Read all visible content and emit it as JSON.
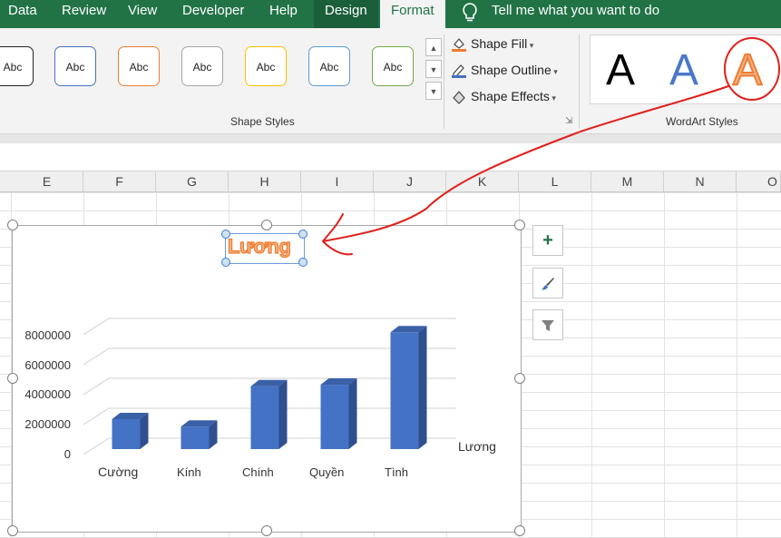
{
  "ribbon_tabs": {
    "data": "Data",
    "review": "Review",
    "view": "View",
    "developer": "Developer",
    "help": "Help",
    "design": "Design",
    "format": "Format",
    "tell_me": "Tell me what you want to do"
  },
  "shape_styles": {
    "thumb_label": "Abc",
    "thumb_colors": [
      "#222222",
      "#4472c4",
      "#ed7d31",
      "#a5a5a5",
      "#ffc000",
      "#5b9bd5",
      "#70ad47"
    ],
    "group_label": "Shape Styles",
    "shape_fill": "Shape Fill",
    "shape_outline": "Shape Outline",
    "shape_effects": "Shape Effects"
  },
  "wordart": {
    "letter": "A",
    "group_label": "WordArt Styles",
    "styles": [
      "black",
      "blue",
      "orange-outline"
    ]
  },
  "columns": [
    "E",
    "F",
    "G",
    "H",
    "I",
    "J",
    "K",
    "L",
    "M",
    "N",
    "O"
  ],
  "chart_data": {
    "type": "bar",
    "title": "Lương",
    "categories": [
      "Cường",
      "Kính",
      "Chính",
      "Quyền",
      "Tình"
    ],
    "series": [
      {
        "name": "Lương",
        "values": [
          2000000,
          1500000,
          4200000,
          4300000,
          7800000
        ],
        "color": "#4472c4"
      }
    ],
    "yticks": [
      "8000000",
      "6000000",
      "4000000",
      "2000000",
      "0"
    ],
    "ylim": [
      0,
      8000000
    ],
    "gridlines": true,
    "legend": "right"
  },
  "chart_buttons": [
    "plus-icon",
    "brush-icon",
    "filter-icon"
  ],
  "annotation_color": "#e0201a"
}
